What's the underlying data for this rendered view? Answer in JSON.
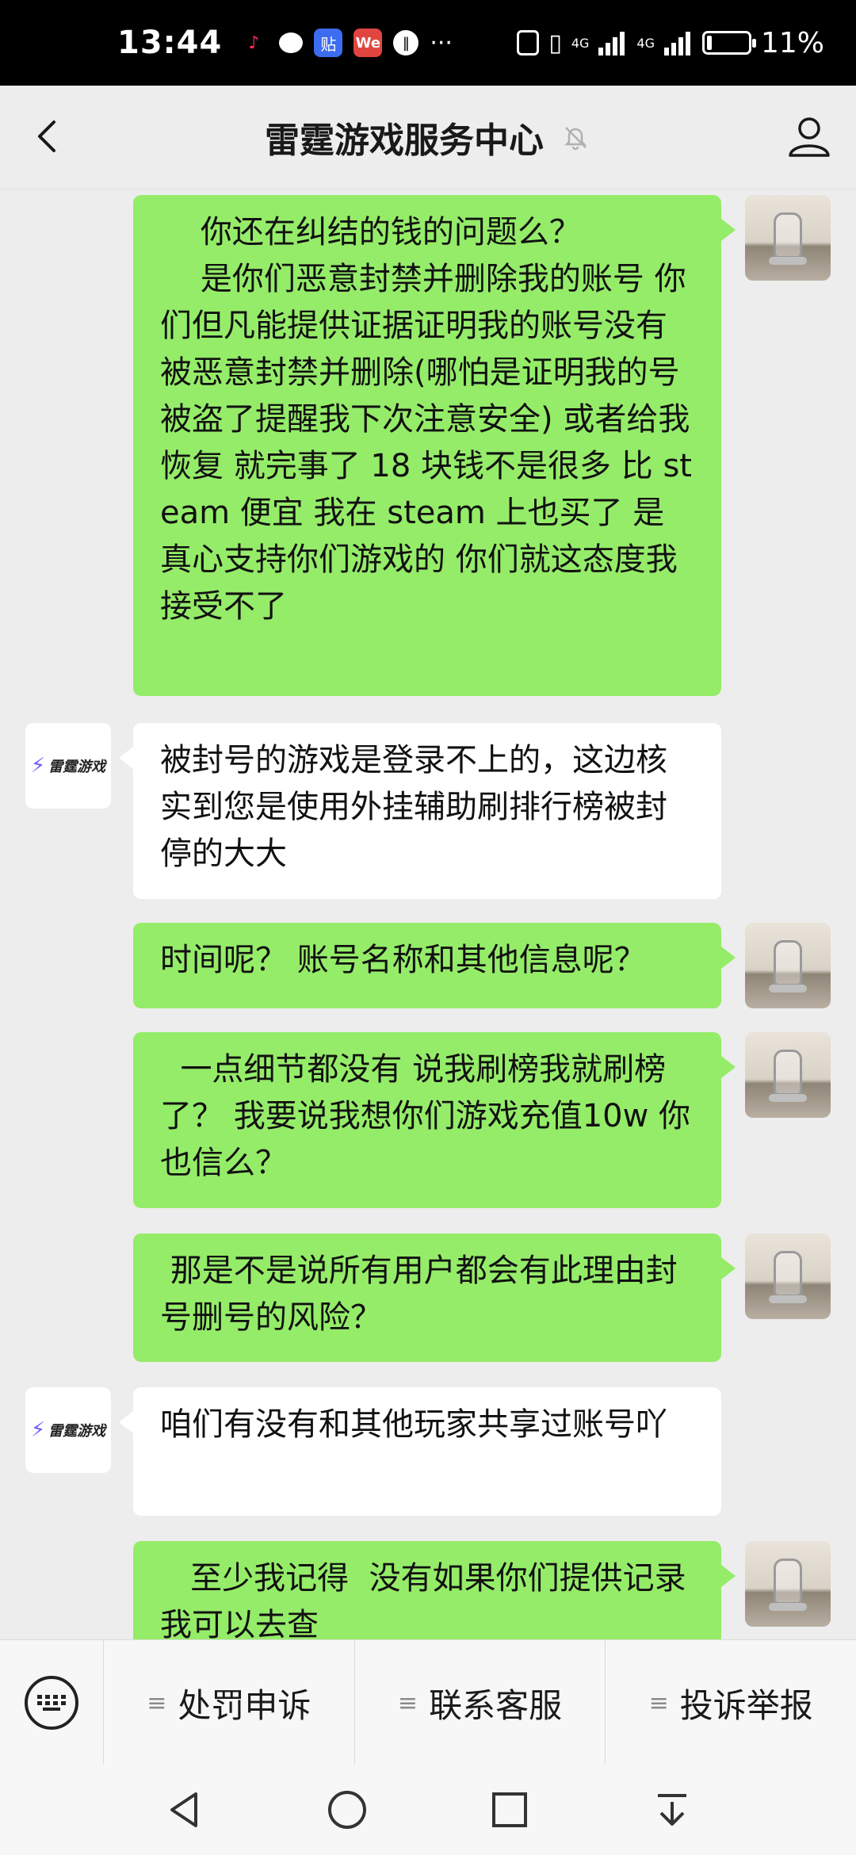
{
  "status_bar": {
    "time": "13:44",
    "network_1": "4G",
    "network_2": "4G",
    "battery": "11%",
    "battery_level": 0.11,
    "more": "···"
  },
  "nav": {
    "title": "雷霆游戏服务中心"
  },
  "messages": [
    {
      "from": "me",
      "text": "    你还在纠结的钱的问题么？\n    是你们恶意封禁并删除我的账号 你们但凡能提供证据证明我的账号没有被恶意封禁并删除(哪怕是证明我的号被盗了提醒我下次注意安全) 或者给我恢复 就完事了 18 块钱不是很多 比 steam 便宜 我在 steam 上也买了 是真心支持你们游戏的 你们就这态度我接受不了"
    },
    {
      "from": "them",
      "text": "被封号的游戏是登录不上的，这边核实到您是使用外挂辅助刷排行榜被封停的大大"
    },
    {
      "from": "me",
      "text": "时间呢？ 账号名称和其他信息呢？"
    },
    {
      "from": "me",
      "text": "  一点细节都没有 说我刷榜我就刷榜了？ 我要说我想你们游戏充值10w 你也信么？"
    },
    {
      "from": "me",
      "text": " 那是不是说所有用户都会有此理由封号删号的风险？"
    },
    {
      "from": "them",
      "text": "咱们有没有和其他玩家共享过账号吖"
    },
    {
      "from": "me",
      "text": "   至少我记得  没有如果你们提供记录 我可以去查"
    }
  ],
  "them_avatar": {
    "brand": "雷霆游戏"
  },
  "bottom_menu": {
    "items": [
      "处罚申诉",
      "联系客服",
      "投诉举报"
    ]
  }
}
